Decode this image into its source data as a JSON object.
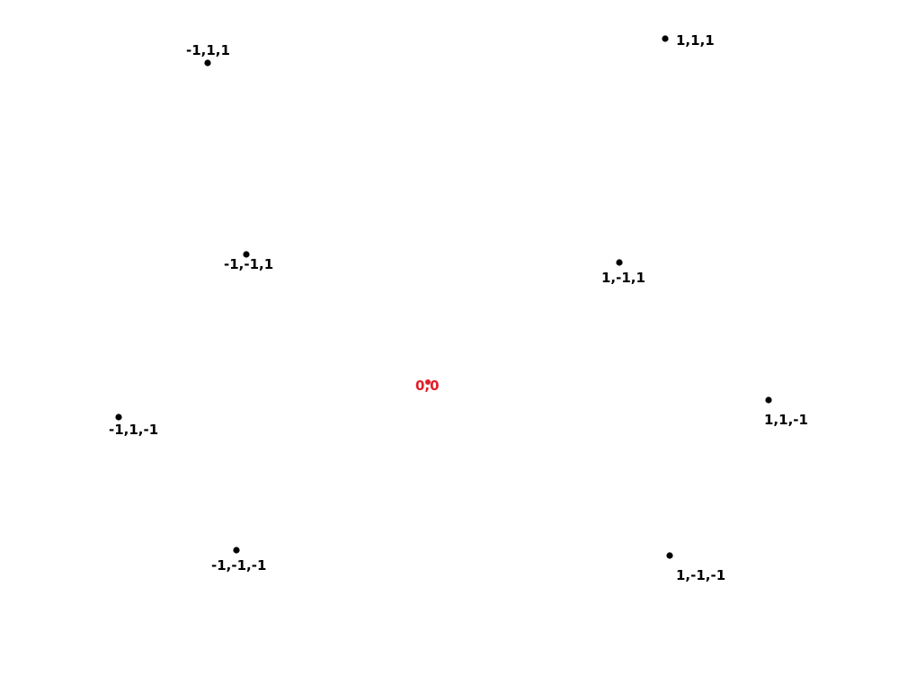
{
  "colors": {
    "background": "#ffffff",
    "point": "#000000",
    "origin": "#e0202a"
  },
  "points": [
    {
      "label": "-1,1,1"
    },
    {
      "label": "1,1,1"
    },
    {
      "label": "-1,-1,1"
    },
    {
      "label": "1,-1,1"
    },
    {
      "label": "-1,1,-1"
    },
    {
      "label": "1,1,-1"
    },
    {
      "label": "-1,-1,-1"
    },
    {
      "label": "1,-1,-1"
    }
  ],
  "origin": {
    "label": "0,0"
  }
}
